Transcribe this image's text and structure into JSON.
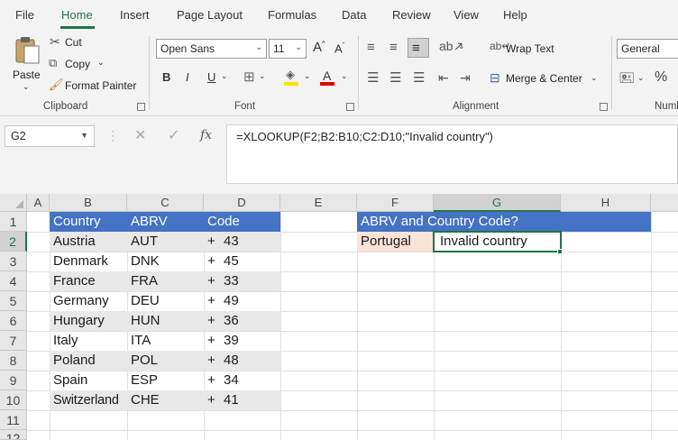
{
  "menu": {
    "tabs": [
      "File",
      "Home",
      "Insert",
      "Page Layout",
      "Formulas",
      "Data",
      "Review",
      "View",
      "Help"
    ],
    "active": "Home"
  },
  "ribbon": {
    "clipboard": {
      "paste": "Paste",
      "cut": "Cut",
      "copy": "Copy",
      "format_painter": "Format Painter",
      "label": "Clipboard"
    },
    "font": {
      "name": "Open Sans",
      "size": "11",
      "grow": "A",
      "shrink": "A",
      "bold": "B",
      "italic": "I",
      "underline": "U",
      "font_color": "A",
      "label": "Font"
    },
    "alignment": {
      "wrap_text": "Wrap Text",
      "merge_center": "Merge & Center",
      "label": "Alignment"
    },
    "number": {
      "format": "General",
      "label": "Numb"
    }
  },
  "formula_bar": {
    "name_box": "G2",
    "formula": "=XLOOKUP(F2;B2:B10;C2:D10;\"Invalid country\")",
    "fx": "fx"
  },
  "grid": {
    "columns": [
      "A",
      "B",
      "C",
      "D",
      "E",
      "F",
      "G",
      "H"
    ],
    "rows": [
      "1",
      "2",
      "3",
      "4",
      "5",
      "6",
      "7",
      "8",
      "9",
      "10",
      "11",
      "12"
    ],
    "header": {
      "country": "Country",
      "abrv": "ABRV",
      "code": "Code"
    },
    "countries": [
      {
        "name": "Austria",
        "abrv": "AUT",
        "plus": "+",
        "code": "43"
      },
      {
        "name": "Denmark",
        "abrv": "DNK",
        "plus": "+",
        "code": "45"
      },
      {
        "name": "France",
        "abrv": "FRA",
        "plus": "+",
        "code": "33"
      },
      {
        "name": "Germany",
        "abrv": "DEU",
        "plus": "+",
        "code": "49"
      },
      {
        "name": "Hungary",
        "abrv": "HUN",
        "plus": "+",
        "code": "36"
      },
      {
        "name": "Italy",
        "abrv": "ITA",
        "plus": "+",
        "code": "39"
      },
      {
        "name": "Poland",
        "abrv": "POL",
        "plus": "+",
        "code": "48"
      },
      {
        "name": "Spain",
        "abrv": "ESP",
        "plus": "+",
        "code": "34"
      },
      {
        "name": "Switzerland",
        "abrv": "CHE",
        "plus": "+",
        "code": "41"
      }
    ],
    "lookup_title": "ABRV and Country Code?",
    "lookup_input": "Portugal",
    "lookup_result": "Invalid country"
  },
  "colors": {
    "accent": "#217346",
    "table_header": "#4472c4",
    "band": "#e8e8e8",
    "input_fill": "#fbe3d6"
  }
}
